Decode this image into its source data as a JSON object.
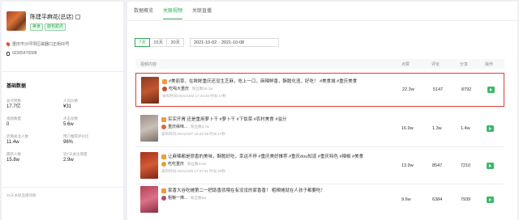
{
  "shop": {
    "name": "陈建平麻花(总店)",
    "tags": [
      "美食",
      "面包甜点"
    ],
    "address": "重庆市沙坪坝区磁器口正街60号",
    "phone": "02365476588"
  },
  "basic": {
    "title": "基础数据",
    "stats": [
      {
        "label": "总点赞数",
        "value": "17.7亿"
      },
      {
        "label": "人均价格",
        "value": "¥31"
      },
      {
        "label": "视频数量",
        "value": "0"
      },
      {
        "label": "点击总数",
        "value": "5.6w"
      },
      {
        "label": "近期关注人数",
        "value": "11.4w"
      },
      {
        "label": "用户推荐评论比",
        "value": "96%"
      },
      {
        "label": "最新人数",
        "value": "15.8w"
      },
      {
        "label": "近7天关注增量",
        "value": "2.9w"
      }
    ],
    "footnote": "30天关联直播场数"
  },
  "tabs": [
    {
      "label": "数据概览",
      "active": false
    },
    {
      "label": "关联视频",
      "active": true
    },
    {
      "label": "关联直播",
      "active": false
    }
  ],
  "filters": {
    "ranges": [
      {
        "label": "7天",
        "active": true
      },
      {
        "label": "15天",
        "active": false
      },
      {
        "label": "30天",
        "active": false
      }
    ],
    "date_start": "2021-10-02",
    "date_sep": "-",
    "date_end": "2021-10-08"
  },
  "table": {
    "headers": {
      "content": "视频内容",
      "likes": "点赞",
      "comments": "评论",
      "shares": "分享",
      "action": "操作"
    },
    "rows": [
      {
        "title": "#美丽草，在眸眸重庆还没生芝麻，吃上一口，麻辣鲜香，酥脆化渣，好吃！ #美食城 #重庆美食",
        "author": "吃喝大重庆",
        "fans": "粉丝数16.1w",
        "meta": "发布时间:2021/10/2 17:44:40  时长:17秒",
        "likes": "22.3w",
        "comments": "5147",
        "shares": "8792",
        "highlighted": true,
        "thumb_colors": [
          "#8c3a22",
          "#c2572f",
          "#6b2a18"
        ],
        "avatar_color": "#c94a3c"
      },
      {
        "title": "实实开胃 还是重用萝卜干 #萝卜干 #下饭菜 #农村美食 #溢分",
        "author": "重庆缘味...",
        "fans": "粉丝数3.7w",
        "meta": "发布时间:2021/10/7 10:43:35  时长:17秒",
        "likes": "16.9w",
        "comments": "1.3w",
        "shares": "1.4w",
        "highlighted": false,
        "thumb_colors": [
          "#9a8f88",
          "#c9c0b8",
          "#7b6e66"
        ],
        "avatar_color": "#d96b3a"
      },
      {
        "title": "让麻辣都是很香的美味，酥脆好吃，幸运不停 #重庆美好推荐 #重庆dou知道 #重庆特色 #辣椒 #美食",
        "author": "吃吃重庆",
        "fans": "粉丝数3.2w",
        "meta": "发布时间:2021/10/6 17:27:51  时长:20秒",
        "likes": "13.9w",
        "comments": "8547",
        "shares": "7210",
        "highlighted": false,
        "thumb_colors": [
          "#a6321e",
          "#d25a35",
          "#7d2414"
        ],
        "avatar_color": "#e0a13a"
      },
      {
        "title": "家香大谷吃摊第二一把助香就喂在有没没的家香香！ 粗粮摊就在人孩子都要吃！",
        "author": "粗粮一捧...",
        "fans": "粉丝数5w",
        "meta": "",
        "likes": "9.6w",
        "comments": "6384",
        "shares": "7939",
        "highlighted": false,
        "thumb_colors": [
          "#b8405a",
          "#d8728a",
          "#8a2c40"
        ],
        "avatar_color": "#b84a6a"
      }
    ]
  }
}
